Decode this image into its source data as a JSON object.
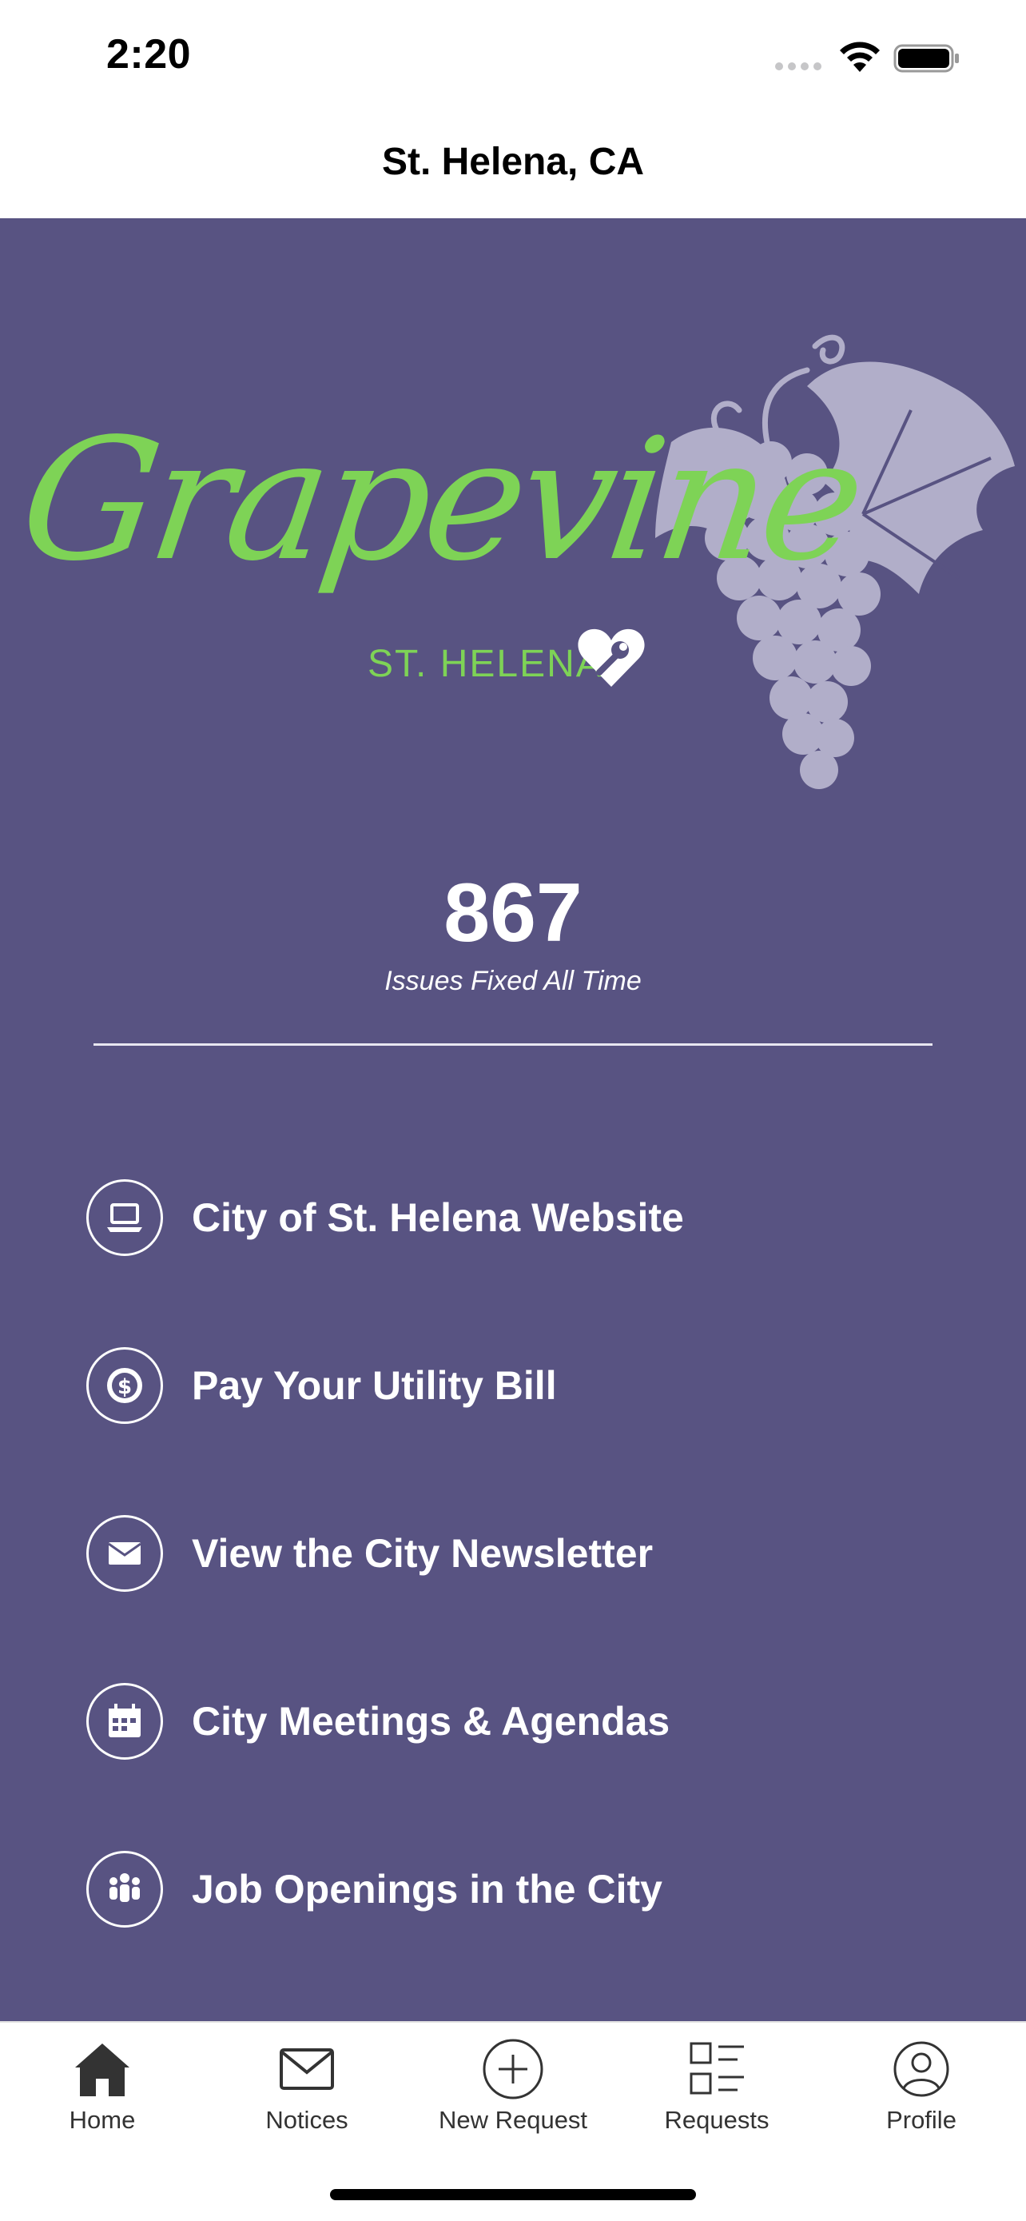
{
  "status_bar": {
    "time": "2:20"
  },
  "header": {
    "title": "St. Helena, CA"
  },
  "logo": {
    "script_text": "Grapevine",
    "sub_text": "ST. HELENA"
  },
  "stats": {
    "issues_fixed": "867",
    "issues_fixed_label": "Issues Fixed All Time"
  },
  "links": [
    {
      "label": "City of St. Helena Website",
      "icon": "laptop-icon"
    },
    {
      "label": "Pay Your Utility Bill",
      "icon": "dollar-icon"
    },
    {
      "label": "View the City Newsletter",
      "icon": "envelope-icon"
    },
    {
      "label": "City Meetings & Agendas",
      "icon": "calendar-icon"
    },
    {
      "label": "Job Openings in the City",
      "icon": "people-icon"
    }
  ],
  "tabs": [
    {
      "label": "Home",
      "icon": "home-icon",
      "active": true
    },
    {
      "label": "Notices",
      "icon": "mail-icon"
    },
    {
      "label": "New Request",
      "icon": "plus-circle-icon"
    },
    {
      "label": "Requests",
      "icon": "list-icon"
    },
    {
      "label": "Profile",
      "icon": "profile-icon"
    }
  ],
  "colors": {
    "background": "#585382",
    "logo_green": "#7ed356",
    "grapes": "#b1aec9"
  }
}
